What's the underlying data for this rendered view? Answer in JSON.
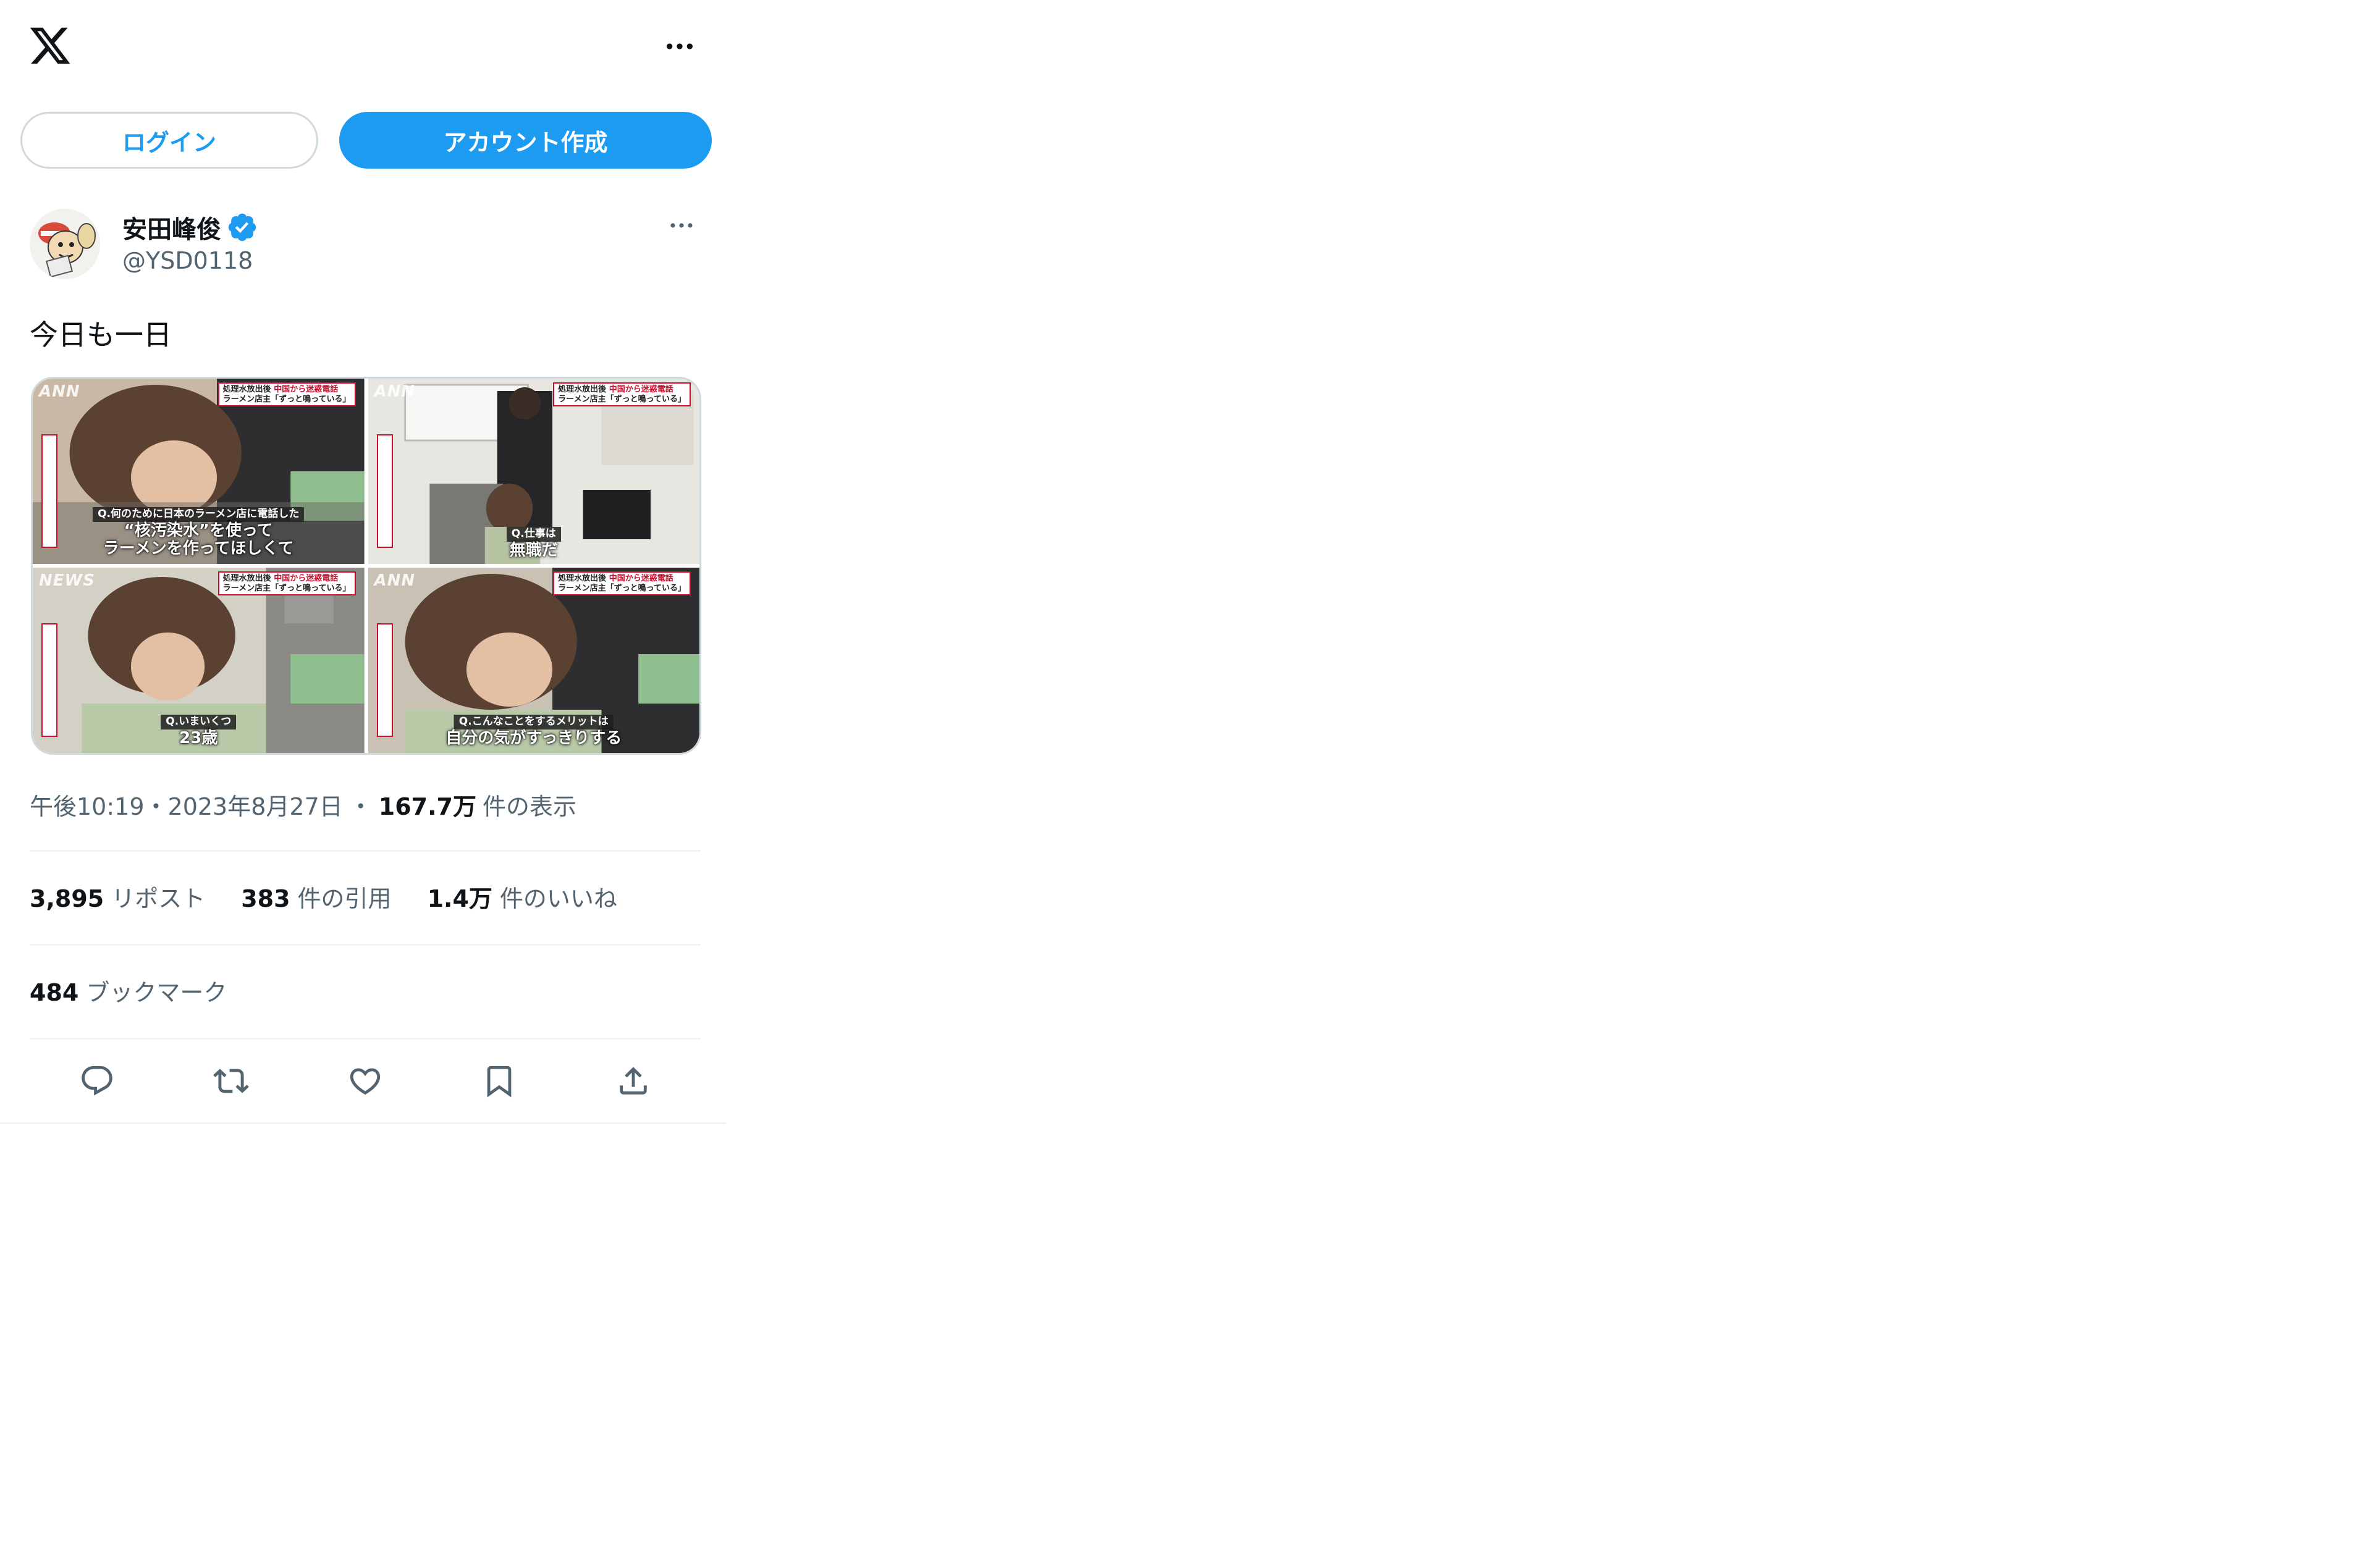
{
  "header": {
    "logo_icon": "x-logo-icon",
    "more_icon": "more-horizontal-icon"
  },
  "auth": {
    "login_label": "ログイン",
    "signup_label": "アカウント作成"
  },
  "tweet": {
    "author_name": "安田峰俊",
    "author_handle": "@YSD0118",
    "verified_icon": "verified-badge-icon",
    "text": "今日も一日",
    "media": [
      {
        "logo": "ANN",
        "badge_line1_black": "処理水放出後",
        "badge_line1_red": "中国から迷惑電話",
        "badge_line2": "ラーメン店主「ずっと鳴っている」",
        "question": "Q.何のために日本のラーメン店に電話した",
        "answer_line1": "“核汚染水”を使って",
        "answer_line2": "ラーメンを作ってほしくて"
      },
      {
        "logo": "ANN",
        "badge_line1_black": "処理水放出後",
        "badge_line1_red": "中国から迷惑電話",
        "badge_line2": "ラーメン店主「ずっと鳴っている」",
        "question": "Q.仕事は",
        "answer_line1": "無職だ",
        "answer_line2": ""
      },
      {
        "logo": "NEWS",
        "badge_line1_black": "処理水放出後",
        "badge_line1_red": "中国から迷惑電話",
        "badge_line2": "ラーメン店主「ずっと鳴っている」",
        "question": "Q.いまいくつ",
        "answer_line1": "23歳",
        "answer_line2": ""
      },
      {
        "logo": "ANN",
        "badge_line1_black": "処理水放出後",
        "badge_line1_red": "中国から迷惑電話",
        "badge_line2": "ラーメン店主「ずっと鳴っている」",
        "question": "Q.こんなことをするメリットは",
        "answer_line1": "自分の気がすっきりする",
        "answer_line2": ""
      }
    ],
    "time": "午後10:19",
    "sep1": "・",
    "date": "2023年8月27日",
    "sep2": "・",
    "views_count": "167.7万",
    "views_label": "件の表示",
    "reposts_count": "3,895",
    "reposts_label": "リポスト",
    "quotes_count": "383",
    "quotes_label": "件の引用",
    "likes_count": "1.4万",
    "likes_label": "件のいいね",
    "bookmarks_count": "484",
    "bookmarks_label": "ブックマーク"
  },
  "actions": [
    {
      "icon": "reply-icon"
    },
    {
      "icon": "repost-icon"
    },
    {
      "icon": "like-icon"
    },
    {
      "icon": "bookmark-icon"
    },
    {
      "icon": "share-icon"
    }
  ],
  "colors": {
    "accent": "#1d9bf0",
    "text_primary": "#0f1419",
    "text_secondary": "#536471",
    "divider": "#eff3f4"
  }
}
